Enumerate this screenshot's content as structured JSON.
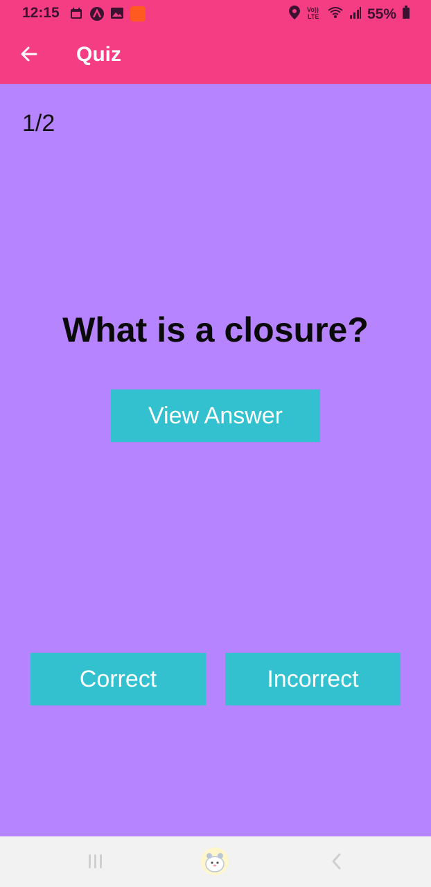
{
  "status_bar": {
    "time": "12:15",
    "battery": "55%",
    "icons": [
      "calendar-icon",
      "app-a-icon",
      "gallery-icon",
      "app-square-icon",
      "location-icon",
      "volte-icon",
      "wifi-icon",
      "signal-icon",
      "battery-icon"
    ]
  },
  "app_bar": {
    "title": "Quiz",
    "back_icon": "arrow-back-icon"
  },
  "quiz": {
    "counter": "1/2",
    "question": "What is a closure?",
    "view_answer_label": "View Answer",
    "correct_label": "Correct",
    "incorrect_label": "Incorrect"
  },
  "nav_bar": {
    "icons": [
      "recents-icon",
      "home-icon",
      "back-nav-icon"
    ]
  },
  "colors": {
    "app_bar": "#f53d84",
    "background": "#b784ff",
    "button": "#33c1d0",
    "nav_bar": "#f2f2f2"
  }
}
